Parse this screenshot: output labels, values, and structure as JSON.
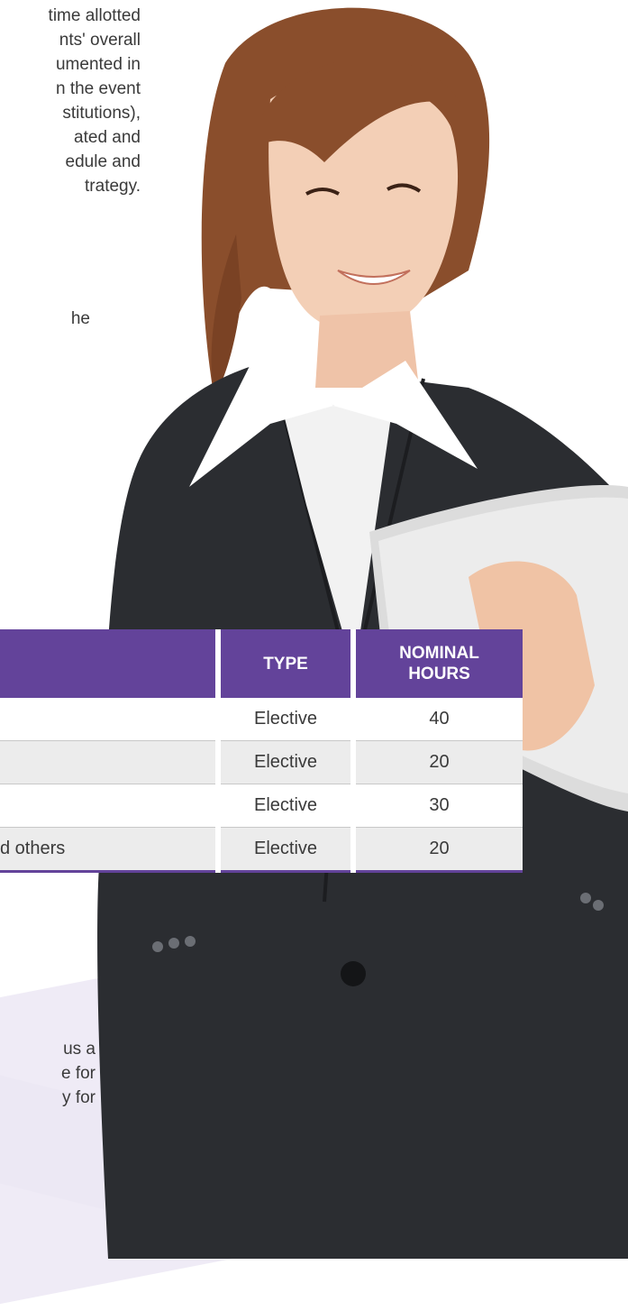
{
  "paragraph_top": [
    "time allotted",
    "nts' overall",
    "umented in",
    "n the event",
    "stitutions),",
    "ated and",
    "edule and",
    "trategy."
  ],
  "paragraph_mid": [
    "he"
  ],
  "paragraph_bottom": [
    "us a",
    "e for",
    "y for"
  ],
  "table": {
    "headers": {
      "unit": "",
      "type": "TYPE",
      "hours_line1": "NOMINAL",
      "hours_line2": "HOURS"
    },
    "rows": [
      {
        "unit": "",
        "type": "Elective",
        "hours": "40"
      },
      {
        "unit": "",
        "type": "Elective",
        "hours": "20"
      },
      {
        "unit": "",
        "type": "Elective",
        "hours": "30"
      },
      {
        "unit": "d others",
        "type": "Elective",
        "hours": "20"
      }
    ]
  },
  "colors": {
    "header_bg": "#63439a",
    "accent": "#63439a",
    "row_alt": "#ececec"
  }
}
